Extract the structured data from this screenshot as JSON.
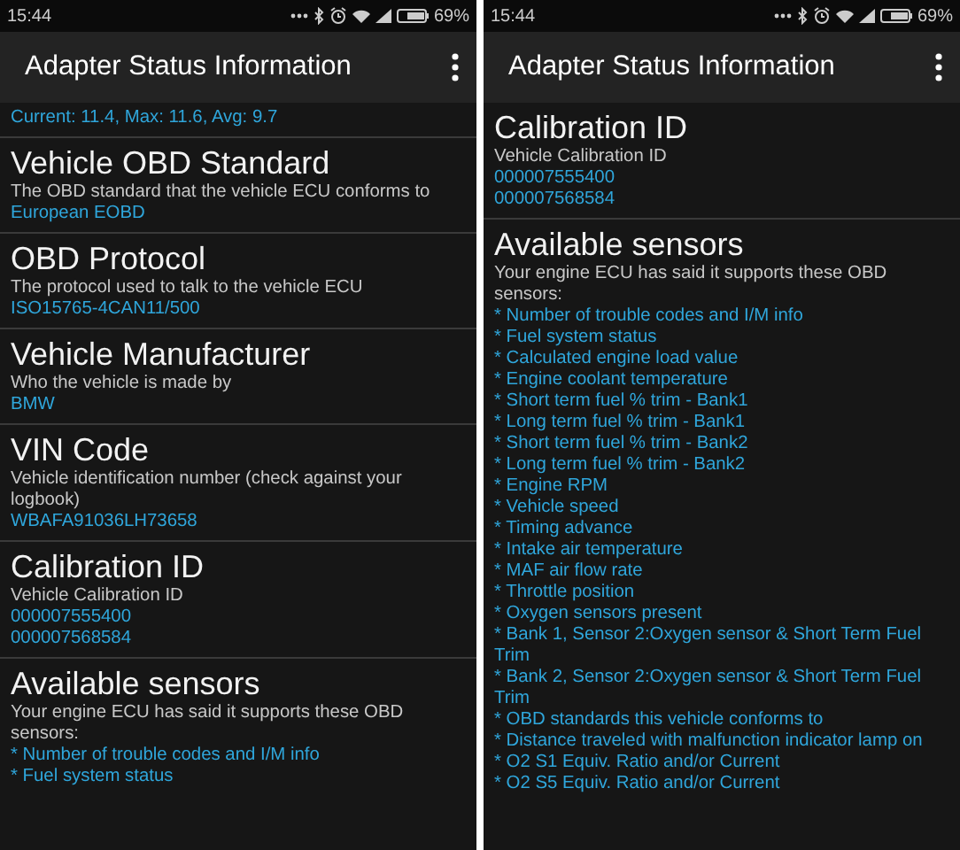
{
  "screens": [
    {
      "status_bar": {
        "time": "15:44",
        "battery": "69%"
      },
      "app_bar": {
        "title": "Adapter Status Information"
      },
      "sections": [
        {
          "values": [
            "Current: 11.4, Max: 11.6, Avg: 9.7"
          ]
        },
        {
          "title": "Vehicle OBD Standard",
          "description": "The OBD standard that the vehicle ECU conforms to",
          "values": [
            " European EOBD"
          ]
        },
        {
          "title": "OBD Protocol",
          "description": "The protocol used to talk to the vehicle ECU",
          "values": [
            "ISO15765-4CAN11/500"
          ]
        },
        {
          "title": "Vehicle Manufacturer",
          "description": "Who the vehicle is made by",
          "values": [
            "BMW"
          ]
        },
        {
          "title": "VIN Code",
          "description": "Vehicle identification number (check against your logbook)",
          "values": [
            "WBAFA91036LH73658"
          ]
        },
        {
          "title": "Calibration ID",
          "description": "Vehicle Calibration ID",
          "values": [
            "000007555400",
            "000007568584"
          ]
        },
        {
          "title": "Available sensors",
          "description": "Your engine ECU has said it supports these OBD sensors:",
          "values": [
            "* Number of trouble codes and I/M info",
            "* Fuel system status"
          ]
        }
      ]
    },
    {
      "status_bar": {
        "time": "15:44",
        "battery": "69%"
      },
      "app_bar": {
        "title": "Adapter Status Information"
      },
      "sections": [
        {
          "title": "Calibration ID",
          "description": "Vehicle Calibration ID",
          "values": [
            "000007555400",
            "000007568584"
          ]
        },
        {
          "title": "Available sensors",
          "description": "Your engine ECU has said it supports these OBD sensors:",
          "values": [
            "* Number of trouble codes and I/M info",
            "* Fuel system status",
            "* Calculated engine load value",
            "* Engine coolant temperature",
            "* Short term fuel % trim - Bank1",
            "* Long term fuel % trim - Bank1",
            "* Short term fuel % trim - Bank2",
            "* Long term fuel % trim - Bank2",
            "* Engine RPM",
            "* Vehicle speed",
            "* Timing advance",
            "* Intake air temperature",
            "* MAF air flow rate",
            "* Throttle position",
            "* Oxygen sensors present",
            "* Bank 1, Sensor 2:Oxygen sensor & Short Term Fuel Trim",
            "* Bank 2, Sensor 2:Oxygen sensor & Short Term Fuel Trim",
            "* OBD standards this vehicle conforms to",
            "* Distance traveled with malfunction indicator lamp on",
            "* O2 S1 Equiv. Ratio and/or Current",
            "* O2 S5 Equiv. Ratio and/or Current"
          ]
        }
      ]
    }
  ]
}
